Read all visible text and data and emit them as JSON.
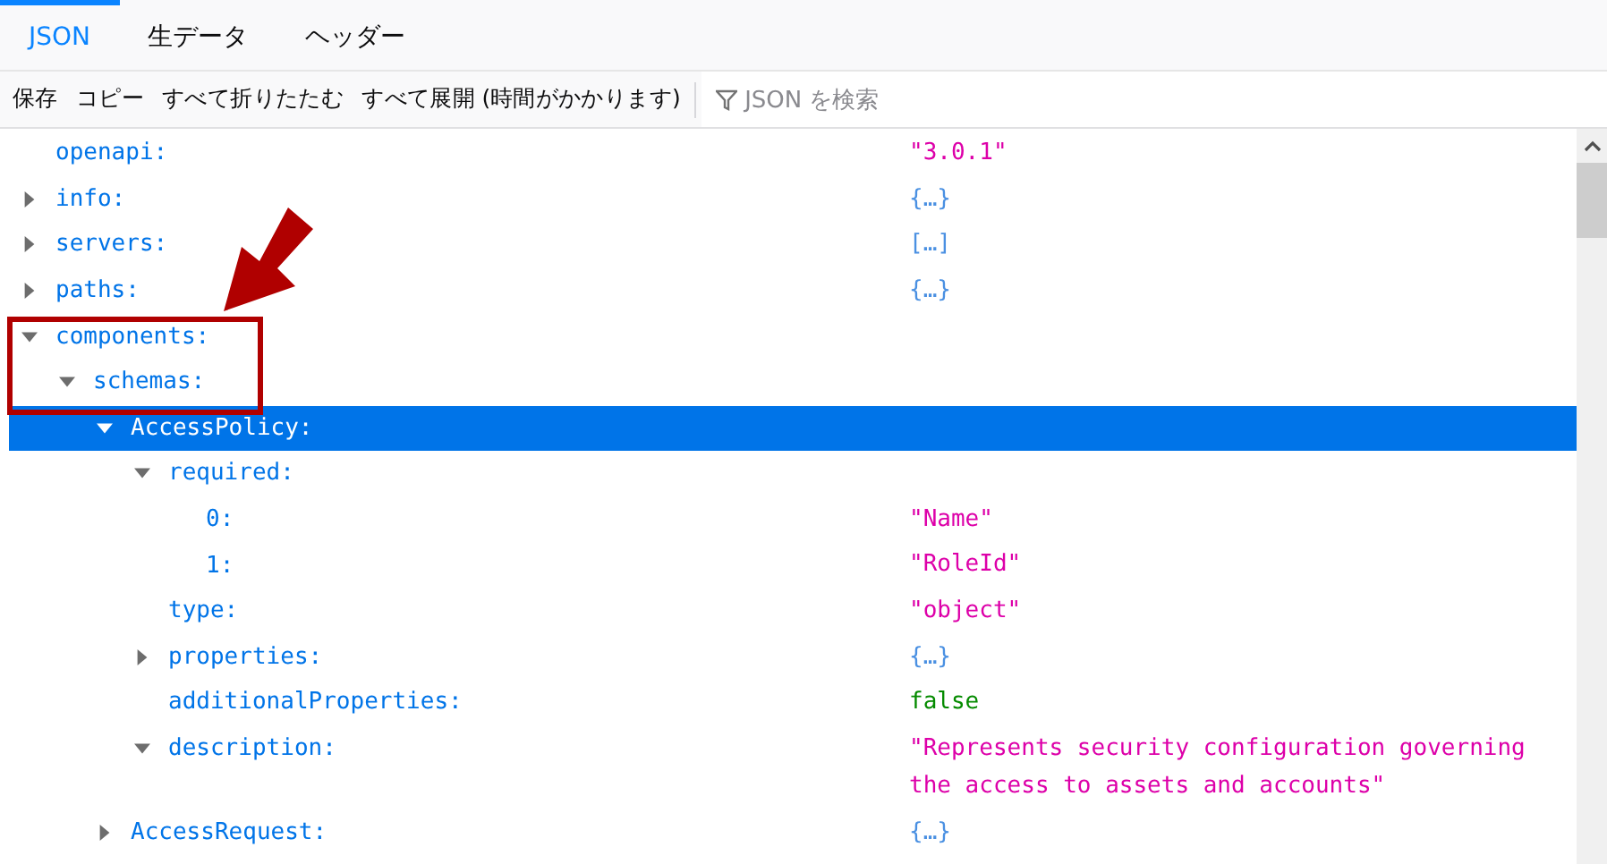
{
  "tabs": [
    {
      "label": "JSON",
      "selected": true
    },
    {
      "label": "生データ",
      "selected": false
    },
    {
      "label": "ヘッダー",
      "selected": false
    }
  ],
  "toolbar": {
    "buttons": [
      "保存",
      "コピー",
      "すべて折りたたむ",
      "すべて展開 (時間がかかります)"
    ],
    "filter": {
      "placeholder": "JSON を検索"
    }
  },
  "tree": [
    {
      "key": "openapi:",
      "value": "\"3.0.1\"",
      "kind": "string",
      "selected": false
    },
    {
      "key": "info:",
      "value": "{…}",
      "kind": "object",
      "expanded": false,
      "selected": false
    },
    {
      "key": "servers:",
      "value": "[…]",
      "kind": "object",
      "expanded": false,
      "selected": false
    },
    {
      "key": "paths:",
      "value": "{…}",
      "kind": "object",
      "expanded": false,
      "selected": false
    },
    {
      "key": "components:",
      "expanded": true,
      "selected": false,
      "children": [
        {
          "key": "schemas:",
          "expanded": true,
          "selected": false,
          "children": [
            {
              "key": "AccessPolicy:",
              "expanded": true,
              "selected": true,
              "children": [
                {
                  "key": "required:",
                  "expanded": true,
                  "selected": false,
                  "children": [
                    {
                      "key": "0:",
                      "value": "\"Name\"",
                      "kind": "string",
                      "selected": false
                    },
                    {
                      "key": "1:",
                      "value": "\"RoleId\"",
                      "kind": "string",
                      "selected": false
                    }
                  ]
                },
                {
                  "key": "type:",
                  "value": "\"object\"",
                  "kind": "string",
                  "selected": false
                },
                {
                  "key": "properties:",
                  "value": "{…}",
                  "kind": "object",
                  "expanded": false,
                  "selected": false
                },
                {
                  "key": "additionalProperties:",
                  "value": "false",
                  "kind": "bool",
                  "selected": false
                },
                {
                  "key": "description:",
                  "value": "\"Represents security configuration governing the access to assets and accounts\"",
                  "kind": "string",
                  "expanded": true,
                  "selected": false
                }
              ]
            },
            {
              "key": "AccessRequest:",
              "value": "{…}",
              "kind": "object",
              "expanded": false,
              "selected": false
            }
          ]
        }
      ]
    }
  ],
  "annotation": {
    "box": true,
    "arrow": true
  }
}
